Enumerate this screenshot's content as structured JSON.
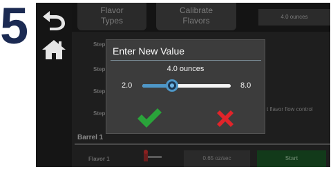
{
  "step_number": "5",
  "sidebar": {
    "back_icon": "back-arrow-icon",
    "home_icon": "home-icon"
  },
  "tabs": [
    {
      "line1": "Flavor",
      "line2": "Types"
    },
    {
      "line1": "Calibrate",
      "line2": "Flavors"
    }
  ],
  "steps": [
    "Step",
    "Step",
    "Step",
    "Step"
  ],
  "value_box": "4.0 ounces",
  "side_text": "t flavor flow control",
  "section": {
    "title": "Barrel 1",
    "row_label": "Flavor 1",
    "row_icon": "flavor-valve-icon",
    "flow_rate": "0.65 oz/sec",
    "start_label": "Start"
  },
  "modal": {
    "title": "Enter New Value",
    "current_value": "4.0 ounces",
    "min_label": "2.0",
    "max_label": "8.0",
    "min": 2.0,
    "max": 8.0,
    "value": 4.0,
    "confirm_icon": "checkmark-icon",
    "cancel_icon": "x-icon"
  },
  "colors": {
    "step_number": "#1b2a52",
    "slider_fill": "#4e97c8",
    "confirm": "#2aa33a",
    "cancel": "#e0242a",
    "start_button": "#123a1a"
  }
}
